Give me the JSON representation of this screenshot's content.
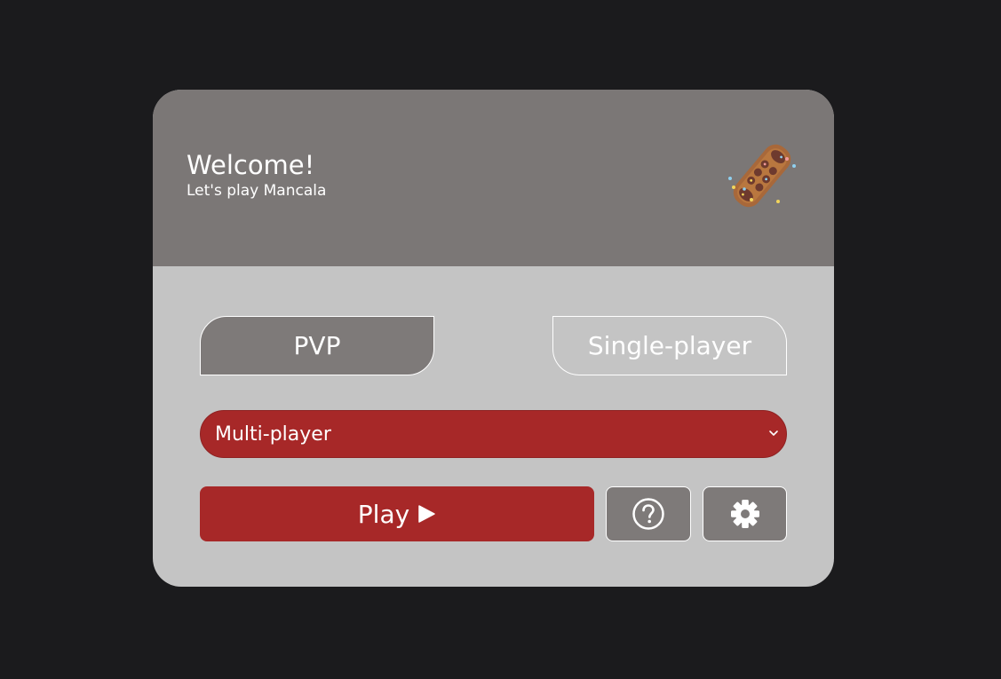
{
  "header": {
    "title": "Welcome!",
    "subtitle": "Let's play Mancala",
    "logo_icon": "mancala-board-icon"
  },
  "modes": {
    "pvp_label": "PVP",
    "single_label": "Single-player",
    "active": "PVP"
  },
  "game_type_select": {
    "selected": "Multi-player",
    "icon": "chevron-down-icon"
  },
  "actions": {
    "play_label": "Play",
    "play_icon": "play-icon",
    "help_icon": "help-icon",
    "settings_icon": "gear-icon"
  },
  "colors": {
    "background": "#1b1b1d",
    "header": "#7b7776",
    "card": "#c4c4c4",
    "accent_red": "#a72828",
    "button_gray": "#7e7a79"
  }
}
